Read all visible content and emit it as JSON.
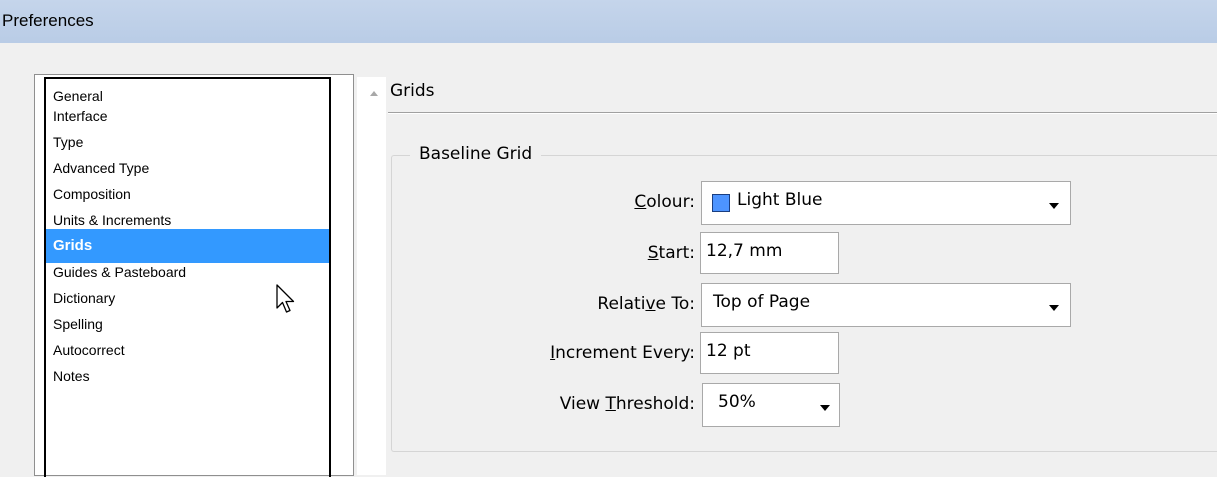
{
  "window": {
    "title": "Preferences"
  },
  "sidebar": {
    "items": [
      {
        "label": "General"
      },
      {
        "label": "Interface"
      },
      {
        "label": "Type"
      },
      {
        "label": "Advanced Type"
      },
      {
        "label": "Composition"
      },
      {
        "label": "Units & Increments"
      },
      {
        "label": "Grids",
        "selected": true
      },
      {
        "label": "Guides & Pasteboard"
      },
      {
        "label": "Dictionary"
      },
      {
        "label": "Spelling"
      },
      {
        "label": "Autocorrect"
      },
      {
        "label": "Notes"
      }
    ],
    "selected_color": "#3399ff"
  },
  "panel": {
    "title": "Grids",
    "baseline_grid": {
      "group_label": "Baseline Grid",
      "colour": {
        "label_pre": "",
        "label_key": "C",
        "label_post": "olour:",
        "value": "Light Blue",
        "swatch_color": "#4d94ff"
      },
      "start": {
        "label_key": "S",
        "label_post": "tart:",
        "value": "12,7 mm"
      },
      "relative_to": {
        "label_pre": "Relati",
        "label_key": "v",
        "label_post": "e To:",
        "value": "Top of Page"
      },
      "increment_every": {
        "label_key": "I",
        "label_post": "ncrement Every:",
        "value": "12 pt"
      },
      "view_threshold": {
        "label_pre": "View ",
        "label_key": "T",
        "label_post": "hreshold:",
        "value": "50%"
      }
    }
  }
}
